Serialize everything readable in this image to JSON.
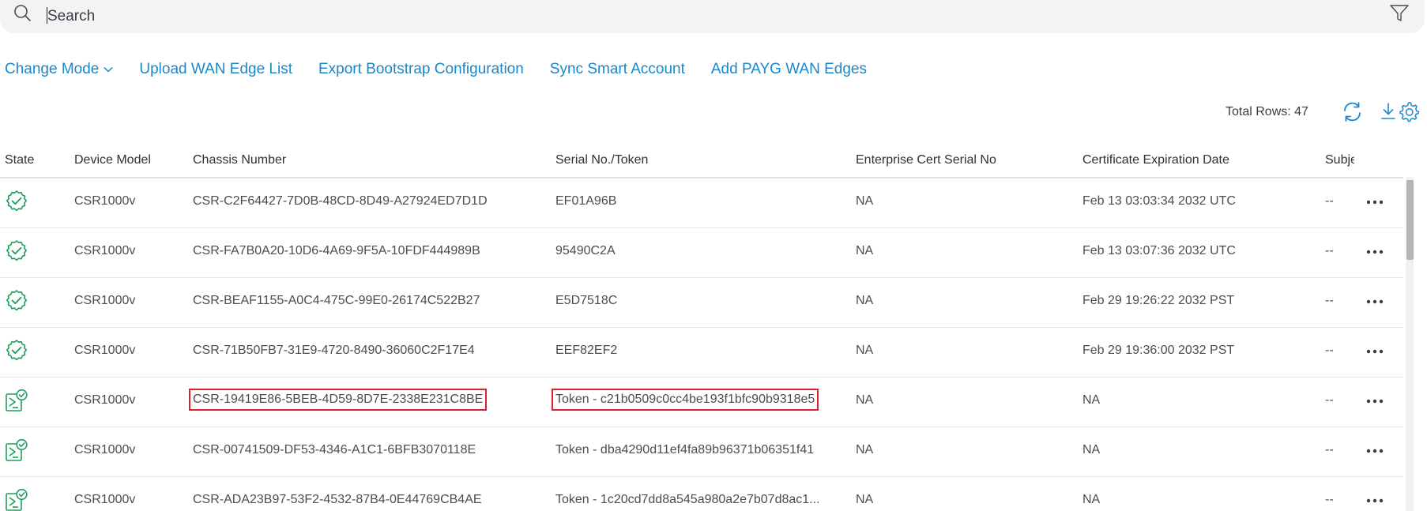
{
  "search": {
    "placeholder": "Search"
  },
  "actions": {
    "change_mode": "Change Mode",
    "upload_list": "Upload WAN Edge List",
    "export_bootstrap": "Export Bootstrap Configuration",
    "sync_smart_account": "Sync Smart Account",
    "add_payg": "Add PAYG WAN Edges"
  },
  "toolbar": {
    "total_rows": "Total Rows: 47"
  },
  "table": {
    "headers": {
      "state": "State",
      "device_model": "Device Model",
      "chassis_number": "Chassis Number",
      "serial_token": "Serial No./Token",
      "enterprise_cert": "Enterprise Cert Serial No",
      "cert_expiration": "Certificate Expiration Date",
      "subject": "Subject"
    },
    "rows": [
      {
        "state": "certificate-verified-icon",
        "device_model": "CSR1000v",
        "chassis": "CSR-C2F64427-7D0B-48CD-8D49-A27924ED7D1D",
        "serial": "EF01A96B",
        "enterprise_cert": "NA",
        "cert_expiration": "Feb 13 03:03:34 2032 UTC",
        "subject": "--"
      },
      {
        "state": "certificate-verified-icon",
        "device_model": "CSR1000v",
        "chassis": "CSR-FA7B0A20-10D6-4A69-9F5A-10FDF444989B",
        "serial": "95490C2A",
        "enterprise_cert": "NA",
        "cert_expiration": "Feb 13 03:07:36 2032 UTC",
        "subject": "--"
      },
      {
        "state": "certificate-verified-icon",
        "device_model": "CSR1000v",
        "chassis": "CSR-BEAF1155-A0C4-475C-99E0-26174C522B27",
        "serial": "E5D7518C",
        "enterprise_cert": "NA",
        "cert_expiration": "Feb 29 19:26:22 2032 PST",
        "subject": "--"
      },
      {
        "state": "certificate-verified-icon",
        "device_model": "CSR1000v",
        "chassis": "CSR-71B50FB7-31E9-4720-8490-36060C2F17E4",
        "serial": "EEF82EF2",
        "enterprise_cert": "NA",
        "cert_expiration": "Feb 29 19:36:00 2032 PST",
        "subject": "--"
      },
      {
        "state": "token-generated-icon",
        "device_model": "CSR1000v",
        "chassis": "CSR-19419E86-5BEB-4D59-8D7E-2338E231C8BE",
        "serial": "Token - c21b0509c0cc4be193f1bfc90b9318e5",
        "enterprise_cert": "NA",
        "cert_expiration": "NA",
        "subject": "--",
        "highlighted": true
      },
      {
        "state": "token-generated-icon",
        "device_model": "CSR1000v",
        "chassis": "CSR-00741509-DF53-4346-A1C1-6BFB3070118E",
        "serial": "Token - dba4290d11ef4fa89b96371b06351f41",
        "enterprise_cert": "NA",
        "cert_expiration": "NA",
        "subject": "--"
      },
      {
        "state": "token-generated-icon",
        "device_model": "CSR1000v",
        "chassis": "CSR-ADA23B97-53F2-4532-87B4-0E44769CB4AE",
        "serial": "Token - 1c20cd7dd8a545a980a2e7b07d8ac1...",
        "enterprise_cert": "NA",
        "cert_expiration": "NA",
        "subject": "--"
      }
    ]
  },
  "colors": {
    "accent": "#1a88c9",
    "state_green": "#1f9e5a",
    "highlight_red": "#e0202c"
  }
}
